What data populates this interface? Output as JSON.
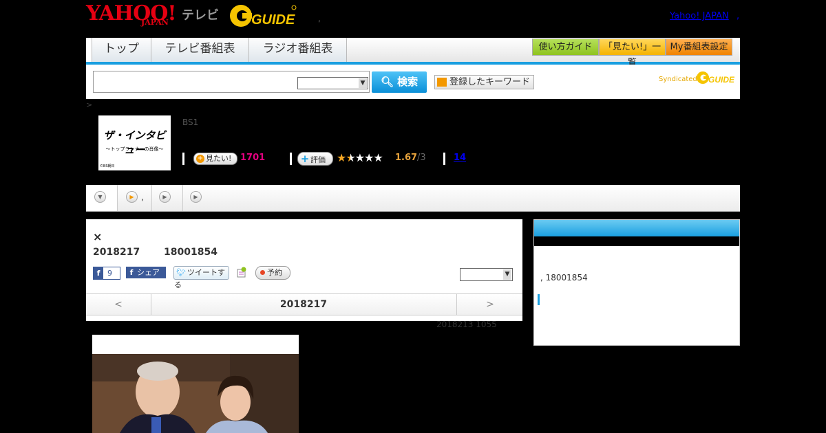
{
  "header": {
    "logo_yahoo": "YAHOO!",
    "logo_japan": "JAPAN",
    "logo_tv": "テレビ",
    "logo_gguide": "G GUIDE",
    "separator": ",",
    "yahoo_japan_link": "Yahoo! JAPAN",
    "link_separator": ","
  },
  "nav": {
    "tabs": [
      {
        "label": "トップ"
      },
      {
        "label": "テレビ番組表"
      },
      {
        "label": "ラジオ番組表"
      }
    ],
    "guide_buttons": [
      {
        "label": "使い方ガイド",
        "color": "#8fc31f"
      },
      {
        "label": "「見たい!」一覧",
        "color": "#f5b300"
      },
      {
        "label": "My番組表設定",
        "color": "#f08300"
      }
    ]
  },
  "search": {
    "input_value": "",
    "select_value": "",
    "button_label": "検索",
    "keyword_button_label": "登録したキーワード",
    "syndicated_label": "Syndicated",
    "syndicated_logo": "G GUIDE"
  },
  "program": {
    "breadcrumb": ">",
    "thumbnail_title": "ザ・インタビュー",
    "thumbnail_subtitle": "〜トップランナーの肖像〜",
    "thumbnail_credit": "©BS朝日",
    "channel": "BS1",
    "want_label": "見たい!",
    "want_count": "1701",
    "rate_label": "評価",
    "rating_value": "1.67",
    "rating_max": "/3",
    "rating_stars": 1.67,
    "review_count": "14"
  },
  "subtabs": [
    {
      "label": ""
    },
    {
      "label": ","
    },
    {
      "label": ""
    },
    {
      "label": ""
    }
  ],
  "detail": {
    "close_mark": "×",
    "date": "2018217",
    "time": "18001854",
    "fb_count": "9",
    "share_label": "シェア",
    "tweet_label": "ツイートする",
    "reserve_label": "予約",
    "select_value": "",
    "prev_arrow": "<",
    "current_date": "2018217",
    "next_arrow": ">",
    "updated": "2018213  1055"
  },
  "side": {
    "time_text": ", 18001854"
  },
  "colors": {
    "accent_blue": "#1a9fe0",
    "yahoo_red": "#e60012",
    "want_pink": "#e3007f",
    "rating_orange": "#e6a23c"
  }
}
